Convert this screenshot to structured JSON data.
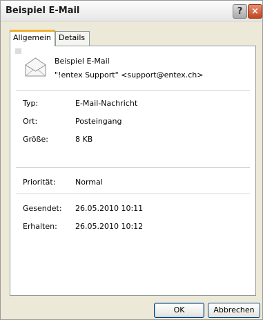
{
  "window": {
    "title": "Beispiel E-Mail"
  },
  "titlebar": {
    "help_glyph": "?",
    "close_glyph": "×"
  },
  "tabs": [
    {
      "label": "Allgemein",
      "active": true
    },
    {
      "label": "Details",
      "active": false
    }
  ],
  "message": {
    "subject": "Beispiel E-Mail",
    "sender": "\"!entex Support\" <support@entex.ch>"
  },
  "properties": [
    {
      "label": "Typ:",
      "value": "E-Mail-Nachricht"
    },
    {
      "label": "Ort:",
      "value": "Posteingang"
    },
    {
      "label": "Größe:",
      "value": "8 KB"
    }
  ],
  "priority": {
    "label": "Priorität:",
    "value": "Normal"
  },
  "dates": [
    {
      "label": "Gesendet:",
      "value": "26.05.2010 10:11"
    },
    {
      "label": "Erhalten:",
      "value": "26.05.2010 10:12"
    }
  ],
  "buttons": {
    "ok": "OK",
    "cancel": "Abbrechen"
  },
  "colors": {
    "accent_tab": "#f0b030",
    "close_button": "#c1441f",
    "button_border": "#003c74"
  }
}
